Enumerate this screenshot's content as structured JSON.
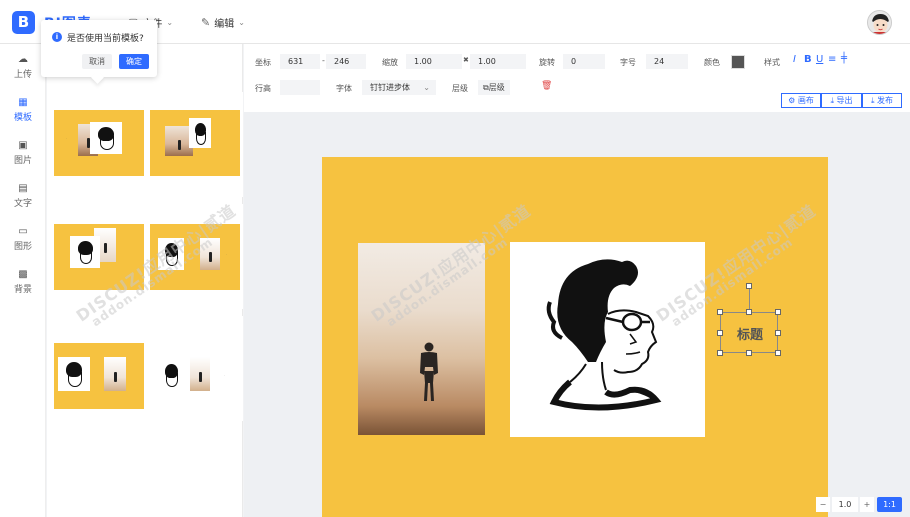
{
  "app": {
    "logo_letter": "B",
    "title": "BI图表"
  },
  "menus": [
    {
      "label": "文件",
      "icon": "file-icon"
    },
    {
      "label": "编辑",
      "icon": "edit-icon"
    }
  ],
  "sidebar": {
    "items": [
      {
        "label": "上传",
        "icon": "upload-cloud-icon",
        "active": false
      },
      {
        "label": "模板",
        "icon": "grid-icon",
        "active": true
      },
      {
        "label": "图片",
        "icon": "image-icon",
        "active": false
      },
      {
        "label": "文字",
        "icon": "text-doc-icon",
        "active": false
      },
      {
        "label": "图形",
        "icon": "folder-icon",
        "active": false
      },
      {
        "label": "背景",
        "icon": "background-image-icon",
        "active": false
      }
    ]
  },
  "popup": {
    "message": "是否使用当前模板?",
    "cancel_label": "取消",
    "ok_label": "确定"
  },
  "toolbar": {
    "coord_label": "坐标",
    "coord_x": "631",
    "coord_sep": "-",
    "coord_y": "246",
    "scale_label": "缩放",
    "scale_x": "1.00",
    "scale_sep": "✖",
    "scale_y": "1.00",
    "rotate_label": "旋转",
    "rotate_value": "0",
    "fontsize_label": "字号",
    "fontsize_value": "24",
    "color_label": "颜色",
    "color_value": "#555555",
    "style_label": "样式",
    "style_italic": "I",
    "style_bold": "B",
    "style_underline": "U",
    "style_align": "≡",
    "style_strike": "╪",
    "lineheight_label": "行高",
    "lineheight_value": "",
    "font_label": "字体",
    "font_value": "钉钉进步体",
    "layer_label": "层级",
    "layer_btn": "⧉层级",
    "canvas_btn": "⚙ 画布",
    "export_btn": "⤓ 导出",
    "publish_btn": "⤓ 发布"
  },
  "canvas": {
    "title_text": "标题",
    "background_color": "#f6c240"
  },
  "zoom": {
    "minus": "−",
    "value": "1.0",
    "plus": "+",
    "reset": "1:1"
  },
  "watermark": {
    "text1": "DISCUZ!应用中心|贰道",
    "text2": "addon.dismall.com"
  }
}
